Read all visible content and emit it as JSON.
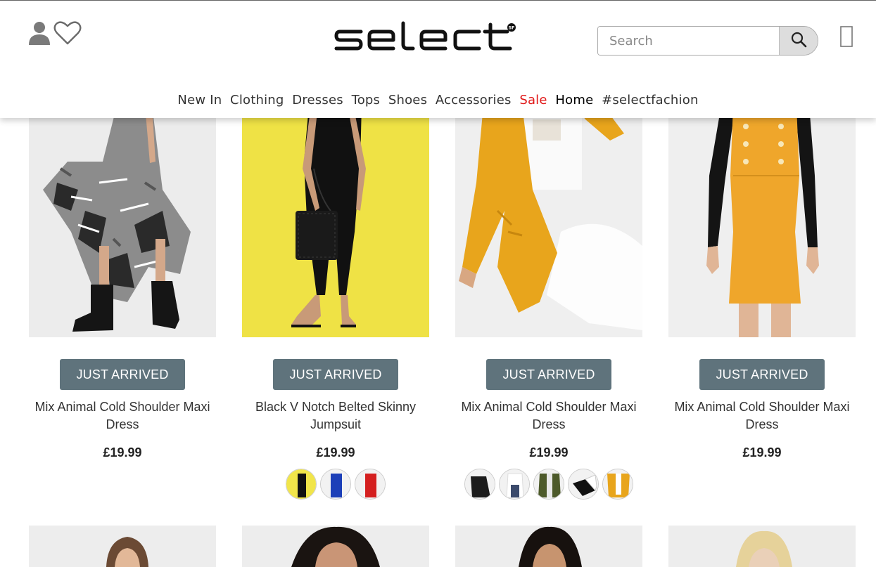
{
  "header": {
    "search_placeholder": "Search",
    "nav": [
      {
        "label": "New In"
      },
      {
        "label": "Clothing"
      },
      {
        "label": "Dresses"
      },
      {
        "label": "Tops"
      },
      {
        "label": "Shoes"
      },
      {
        "label": "Accessories"
      },
      {
        "label": "Sale"
      },
      {
        "label": "Home"
      },
      {
        "label": "#selectfachion"
      }
    ],
    "icons": [
      "user-icon",
      "heart-icon",
      "search-icon",
      "cart-icon"
    ],
    "logo_text": "select"
  },
  "products": [
    {
      "badge": "JUST ARRIVED",
      "title": "Mix Animal Cold Shoulder Maxi Dress",
      "price": "£19.99",
      "swatches": []
    },
    {
      "badge": "JUST ARRIVED",
      "title": "Black V Notch Belted Skinny Jumpsuit",
      "price": "£19.99",
      "swatches": [
        "black",
        "blue",
        "red"
      ]
    },
    {
      "badge": "JUST ARRIVED",
      "title": "Mix Animal Cold Shoulder Maxi Dress",
      "price": "£19.99",
      "swatches": [
        "black",
        "white",
        "khaki",
        "black-white",
        "mustard"
      ]
    },
    {
      "badge": "JUST ARRIVED",
      "title": "Mix Animal Cold Shoulder Maxi Dress",
      "price": "£19.99",
      "swatches": []
    }
  ],
  "colors": {
    "badge_bg": "#5f737c",
    "sale": "#e01818",
    "jumpsuit_bg": "#f1e54a",
    "mustard": "#e8a51c"
  }
}
